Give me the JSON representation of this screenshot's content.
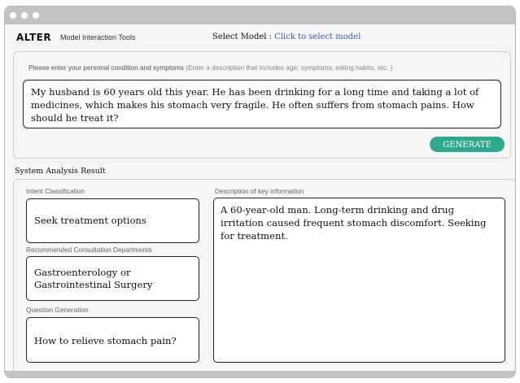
{
  "header": {
    "brand": "ALTER",
    "tools_label": "Model Interaction Tools",
    "select_model_label": "Select Model : ",
    "select_model_link": "Click to select model"
  },
  "input_panel": {
    "prompt": "Please enter your personal condition and symptoms",
    "prompt_hint": "(Enter a description that includes age, symptoms, eating habits, etc. )",
    "input_text": "My husband is 60 years old this year. He has been drinking for a long time and taking a lot of medicines, which makes his stomach very fragile. He often suffers from stomach pains. How should he treat it?",
    "generate_label": "GENERATE",
    "generate_color": "#2fa98e"
  },
  "result": {
    "title": "System Analysis Result",
    "intent_label": "Intent Classification",
    "intent_value": "Seek treatment options",
    "departments_label": "Recommended Consultation Departments",
    "departments_value": "Gastroenterology or Gastrointestinal Surgery",
    "question_label": "Question Generation",
    "question_value": "How to relieve stomach pain?",
    "description_label": "Description of key information",
    "description_value": "A 60-year-old man. Long-term drinking and drug irritation caused frequent stomach discomfort. Seeking for treatment."
  }
}
